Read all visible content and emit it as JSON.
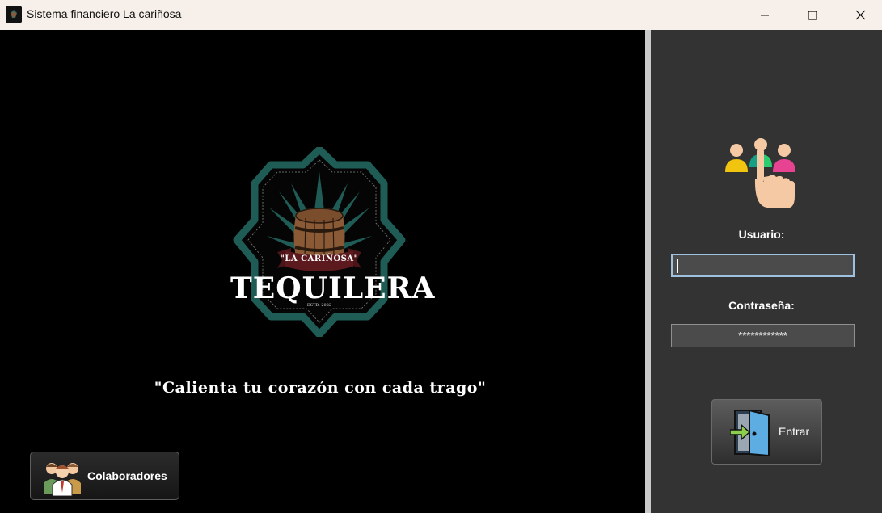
{
  "window": {
    "title": "Sistema financiero La cariñosa",
    "controls": [
      "minimize",
      "maximize",
      "close"
    ]
  },
  "branding": {
    "logo_banner": "\"LA CARIÑOSA\"",
    "logo_name": "TEQUILERA",
    "logo_tag": "ESTD. 2022"
  },
  "slogan": "\"Calienta tu corazón con cada trago\"",
  "collaborators_button": {
    "label": "Colaboradores",
    "icon": "team-icon"
  },
  "login": {
    "icon": "users-select-icon",
    "username_label": "Usuario:",
    "username_value": "",
    "password_label": "Contraseña:",
    "password_value": "************",
    "enter_label": "Entrar",
    "enter_icon": "door-enter-icon"
  },
  "colors": {
    "right_panel": "#333333",
    "left_panel": "#000000",
    "logo_green": "#1f5c55",
    "titlebar": "#f7f0ea"
  }
}
